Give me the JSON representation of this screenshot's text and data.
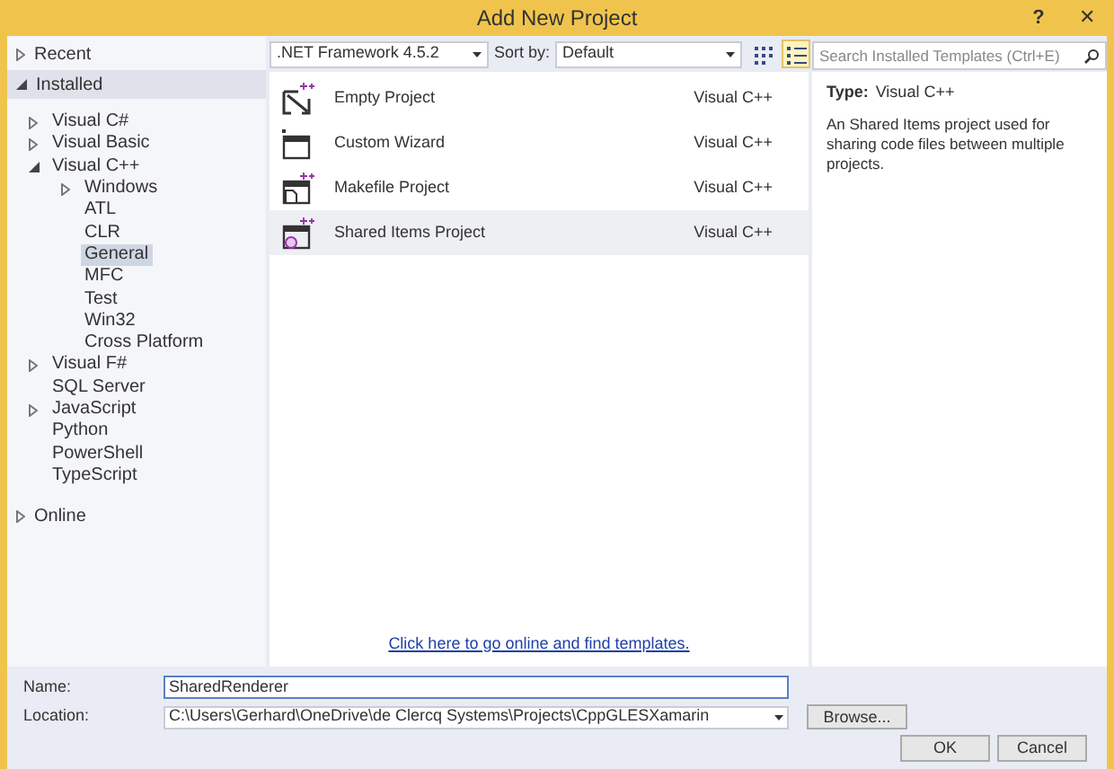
{
  "window": {
    "title": "Add New Project",
    "help": "?",
    "close": "✕"
  },
  "sidebar": {
    "sections": [
      {
        "label": "Recent",
        "expanded": false
      },
      {
        "label": "Installed",
        "expanded": true,
        "children": [
          {
            "label": "Visual C#",
            "expanded": false,
            "selected": false
          },
          {
            "label": "Visual Basic",
            "expanded": false,
            "selected": false
          },
          {
            "label": "Visual C++",
            "expanded": true,
            "selected": false,
            "children": [
              {
                "label": "Windows",
                "expanded": false,
                "selected": false
              },
              {
                "label": "ATL",
                "selected": false
              },
              {
                "label": "CLR",
                "selected": false
              },
              {
                "label": "General",
                "selected": true
              },
              {
                "label": "MFC",
                "selected": false
              },
              {
                "label": "Test",
                "selected": false
              },
              {
                "label": "Win32",
                "selected": false
              },
              {
                "label": "Cross Platform",
                "selected": false
              }
            ]
          },
          {
            "label": "Visual F#",
            "expanded": false,
            "selected": false
          },
          {
            "label": "SQL Server",
            "selected": false
          },
          {
            "label": "JavaScript",
            "expanded": false,
            "selected": false
          },
          {
            "label": "Python",
            "selected": false
          },
          {
            "label": "PowerShell",
            "selected": false
          },
          {
            "label": "TypeScript",
            "selected": false
          }
        ]
      },
      {
        "label": "Online",
        "expanded": false
      }
    ]
  },
  "toolbar": {
    "framework": ".NET Framework 4.5.2",
    "sort_label": "Sort by:",
    "sort_value": "Default",
    "view_modes": [
      {
        "kind": "grid",
        "selected": false
      },
      {
        "kind": "list",
        "selected": true
      }
    ],
    "search": {
      "placeholder": "Search Installed Templates (Ctrl+E)"
    }
  },
  "templates": [
    {
      "kind": "empty",
      "name": "Empty Project",
      "language": "Visual C++",
      "selected": false
    },
    {
      "kind": "wizard",
      "name": "Custom Wizard",
      "language": "Visual C++",
      "selected": false
    },
    {
      "kind": "makefile",
      "name": "Makefile Project",
      "language": "Visual C++",
      "selected": false
    },
    {
      "kind": "shared",
      "name": "Shared Items Project",
      "language": "Visual C++",
      "selected": true
    }
  ],
  "online_link": "Click here to go online and find templates.",
  "details": {
    "type_label": "Type:",
    "type_value": "Visual C++",
    "description": "An Shared Items project used for sharing code files between multiple projects."
  },
  "form": {
    "name_label": "Name:",
    "name_value": "SharedRenderer",
    "location_label": "Location:",
    "location_value": "C:\\Users\\Gerhard\\OneDrive\\de Clercq Systems\\Projects\\CppGLESXamarin",
    "browse": "Browse..."
  },
  "buttons": [
    "OK",
    "Cancel"
  ]
}
